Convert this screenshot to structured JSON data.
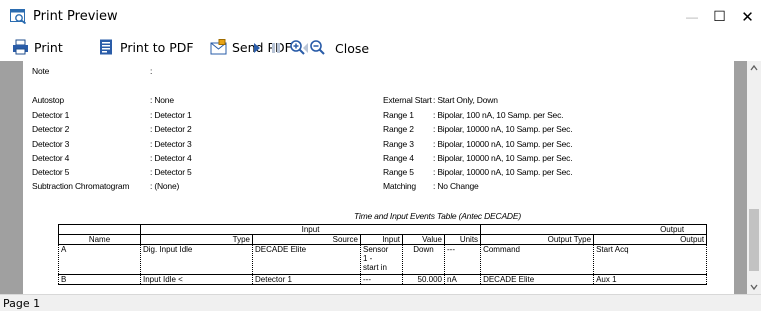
{
  "window": {
    "title": "Print Preview",
    "minimize_glyph": "—",
    "maximize_glyph": "☐",
    "close_glyph": "✕"
  },
  "toolbar": {
    "print_label": "Print",
    "print_pdf_label": "Print to PDF",
    "send_pdf_label": "Send PDF",
    "close_label": "Close"
  },
  "report": {
    "note_label": "Note",
    "note_value": ":",
    "autostop_label": "Autostop",
    "autostop_value": ": None",
    "detectors": [
      {
        "label": "Detector 1",
        "value": ": Detector 1"
      },
      {
        "label": "Detector 2",
        "value": ": Detector 2"
      },
      {
        "label": "Detector 3",
        "value": ": Detector 3"
      },
      {
        "label": "Detector 4",
        "value": ": Detector 4"
      },
      {
        "label": "Detector 5",
        "value": ": Detector 5"
      }
    ],
    "subtraction_label": "Subtraction Chromatogram",
    "subtraction_value": ": (None)",
    "external_start_label": "External Start",
    "external_start_value": ": Start Only, Down",
    "ranges": [
      {
        "label": "Range 1",
        "value": ": Bipolar, 100 nA, 10 Samp. per Sec."
      },
      {
        "label": "Range 2",
        "value": ": Bipolar, 10000 nA, 10 Samp. per Sec."
      },
      {
        "label": "Range 3",
        "value": ": Bipolar, 10000 nA, 10 Samp. per Sec."
      },
      {
        "label": "Range 4",
        "value": ": Bipolar, 10000 nA, 10 Samp. per Sec."
      },
      {
        "label": "Range 5",
        "value": ": Bipolar, 10000 nA, 10 Samp. per Sec."
      }
    ],
    "matching_label": "Matching",
    "matching_value": ": No Change"
  },
  "events_table": {
    "title": "Time and Input Events Table (Antec DECADE)",
    "group_input": "Input",
    "group_output": "Output",
    "headers": [
      "Name",
      "Type",
      "Source",
      "Input",
      "Value",
      "Units",
      "Output Type",
      "Output"
    ],
    "rows": [
      {
        "name": "A",
        "type": "Dig. Input Idle",
        "source": "DECADE Elite",
        "input": "Sensor",
        "input2": "1 -",
        "input3": "start in",
        "value": "Down",
        "units": "---",
        "output_type": "Command",
        "output": "Start Acq"
      },
      {
        "name": "B",
        "type": "Input Idle <",
        "source": "Detector 1",
        "input": "---",
        "input2": "",
        "input3": "",
        "value": "50.000",
        "units": "nA",
        "output_type": "DECADE Elite",
        "output": "Aux 1"
      }
    ]
  },
  "status": {
    "page_label": "Page 1"
  }
}
